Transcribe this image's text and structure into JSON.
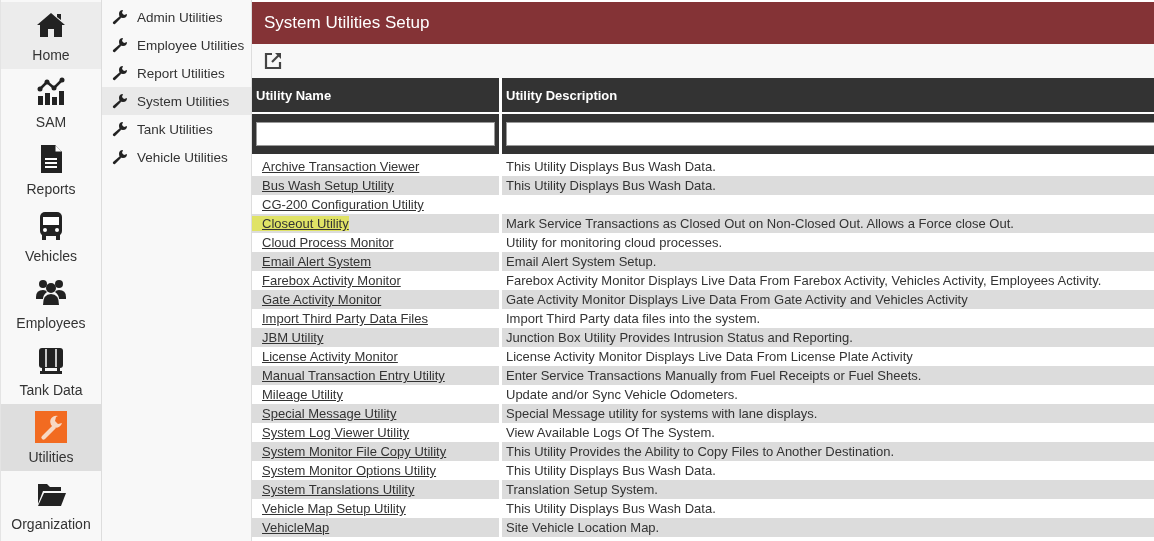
{
  "nav": [
    {
      "label": "Home",
      "selected": false,
      "hovered": true
    },
    {
      "label": "SAM",
      "selected": false,
      "hovered": false
    },
    {
      "label": "Reports",
      "selected": false,
      "hovered": false
    },
    {
      "label": "Vehicles",
      "selected": false,
      "hovered": false
    },
    {
      "label": "Employees",
      "selected": false,
      "hovered": false
    },
    {
      "label": "Tank Data",
      "selected": false,
      "hovered": false
    },
    {
      "label": "Utilities",
      "selected": true,
      "hovered": false
    },
    {
      "label": "Organization",
      "selected": false,
      "hovered": false
    }
  ],
  "submenu": [
    {
      "label": "Admin Utilities",
      "selected": false
    },
    {
      "label": "Employee Utilities",
      "selected": false
    },
    {
      "label": "Report Utilities",
      "selected": false
    },
    {
      "label": "System Utilities",
      "selected": true
    },
    {
      "label": "Tank Utilities",
      "selected": false
    },
    {
      "label": "Vehicle Utilities",
      "selected": false
    }
  ],
  "page_title": "System Utilities Setup",
  "table": {
    "columns": [
      "Utility Name",
      "Utility Description"
    ],
    "rows": [
      {
        "name": "Archive Transaction Viewer",
        "description": "This Utility Displays Bus Wash Data.",
        "highlighted": false
      },
      {
        "name": "Bus Wash Setup Utility",
        "description": "This Utility Displays Bus Wash Data.",
        "highlighted": false
      },
      {
        "name": "CG-200 Configuration Utility",
        "highlighted": false
      },
      {
        "name": "Closeout Utility",
        "description": "Mark Service Transactions as Closed Out on Non-Closed Out. Allows a Force close Out.",
        "highlighted": true
      },
      {
        "name": "Cloud Process Monitor",
        "description": "Utility for monitoring cloud processes.",
        "highlighted": false
      },
      {
        "name": "Email Alert System",
        "description": "Email Alert System Setup.",
        "highlighted": false
      },
      {
        "name": "Farebox Activity Monitor",
        "description": "Farebox Activity Monitor Displays Live Data From Farebox Activity, Vehicles Activity, Employees Activity.",
        "highlighted": false
      },
      {
        "name": "Gate Activity Monitor",
        "description": "Gate Activity Monitor Displays Live Data From Gate Activity and Vehicles Activity",
        "highlighted": false
      },
      {
        "name": "Import Third Party Data Files",
        "description": "Import Third Party data files into the system.",
        "highlighted": false
      },
      {
        "name": "JBM Utility",
        "description": "Junction Box Utility Provides Intrusion Status and Reporting.",
        "highlighted": false
      },
      {
        "name": "License Activity Monitor",
        "description": "License Activity Monitor Displays Live Data From License Plate Activity",
        "highlighted": false
      },
      {
        "name": "Manual Transaction Entry Utility",
        "description": "Enter Service Transactions Manually from Fuel Receipts or Fuel Sheets.",
        "highlighted": false
      },
      {
        "name": "Mileage Utility",
        "description": "Update and/or Sync Vehicle Odometers.",
        "highlighted": false
      },
      {
        "name": "Special Message Utility",
        "description": "Special Message utility for systems with lane displays.",
        "highlighted": false
      },
      {
        "name": "System Log Viewer Utility",
        "description": "View Available Logs Of The System.",
        "highlighted": false
      },
      {
        "name": "System Monitor File Copy Utility",
        "description": "This Utility Provides the Ability to Copy Files to Another Destination.",
        "highlighted": false
      },
      {
        "name": "System Monitor Options Utility",
        "description": "This Utility Displays Bus Wash Data.",
        "highlighted": false
      },
      {
        "name": "System Translations Utility",
        "description": "Translation Setup System.",
        "highlighted": false
      },
      {
        "name": "Vehicle Map Setup Utility",
        "description": "This Utility Displays Bus Wash Data.",
        "highlighted": false
      },
      {
        "name": "VehicleMap",
        "description": "Site Vehicle Location Map.",
        "highlighted": false
      }
    ]
  }
}
